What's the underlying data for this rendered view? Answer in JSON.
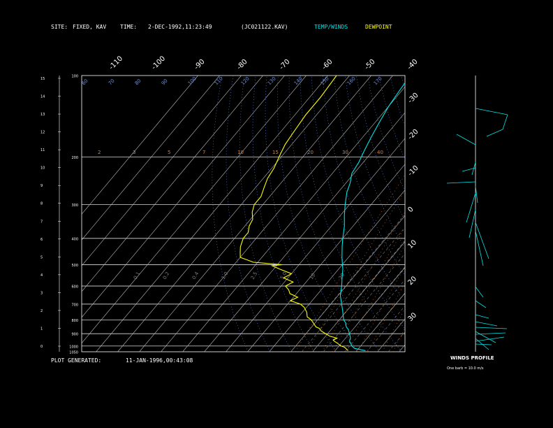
{
  "header": {
    "site_label": "SITE:",
    "site_value": "FIXED, KAV",
    "time_label": "TIME:",
    "time_value": "2-DEC-1992,11:23:49",
    "file_value": "(JC021122.KAV)",
    "temp_legend": "TEMP/WINDS",
    "dew_legend": "DEWPOINT"
  },
  "footer": {
    "generated_label": "PLOT GENERATED:",
    "generated_value": "11-JAN-1996,00:43:08"
  },
  "winds": {
    "title": "WINDS PROFILE",
    "note": "One barb = 10.0 m/s"
  },
  "colors": {
    "temperature": "#00e5e5",
    "dewpoint": "#ffff00",
    "isotherm": "#bbbbbb",
    "mixing_ratio": "#e67e22",
    "dry_adiabat": "#6a8ee6",
    "moist_adiabat": "#7a7a7a"
  },
  "chart_data": {
    "type": "line",
    "yscale": "log-pressure",
    "ylim": [
      1050,
      100
    ],
    "pressure_ticks": [
      "100",
      "200",
      "300",
      "400",
      "500",
      "600",
      "700",
      "800",
      "900",
      "1000",
      "1050"
    ],
    "pressure_values": [
      100,
      200,
      300,
      400,
      500,
      600,
      700,
      800,
      900,
      1000,
      1050
    ],
    "height_ticks": [
      "0",
      "1",
      "2",
      "3",
      "4",
      "5",
      "6",
      "7",
      "8",
      "9",
      "10",
      "11",
      "12",
      "13",
      "14",
      "15"
    ],
    "top_temp_ticks": [
      "-110",
      "-100",
      "-90",
      "-80",
      "-70",
      "-60",
      "-50",
      "-40"
    ],
    "right_temp_ticks": [
      "-30",
      "-20",
      "-10",
      "0",
      "10",
      "20",
      "30"
    ],
    "mixing_ratio_labels": [
      "2",
      "3",
      "5",
      "7",
      "10",
      "15",
      "20",
      "30",
      "40"
    ],
    "dry_adiabat_labels": [
      "60",
      "70",
      "80",
      "90",
      "100",
      "110",
      "120",
      "130",
      "140",
      "150",
      "160",
      "170"
    ],
    "moist_adiabat_labels": [
      "0.1",
      "0.2",
      "0.4",
      "1.0",
      "2.5",
      "5.0",
      "10",
      "20"
    ],
    "series": [
      {
        "name": "TEMP/WINDS",
        "points": [
          [
            1040,
            24
          ],
          [
            1020,
            18
          ],
          [
            1000,
            16
          ],
          [
            960,
            13
          ],
          [
            930,
            12
          ],
          [
            900,
            10
          ],
          [
            870,
            8
          ],
          [
            850,
            6
          ],
          [
            820,
            4
          ],
          [
            800,
            2
          ],
          [
            770,
            0
          ],
          [
            740,
            -2
          ],
          [
            700,
            -5
          ],
          [
            650,
            -9
          ],
          [
            600,
            -12
          ],
          [
            560,
            -15
          ],
          [
            520,
            -18
          ],
          [
            500,
            -20
          ],
          [
            470,
            -23
          ],
          [
            430,
            -27
          ],
          [
            400,
            -30
          ],
          [
            360,
            -34
          ],
          [
            330,
            -38
          ],
          [
            300,
            -42
          ],
          [
            270,
            -46
          ],
          [
            250,
            -48
          ],
          [
            230,
            -51
          ],
          [
            210,
            -52
          ],
          [
            190,
            -54
          ],
          [
            170,
            -56
          ],
          [
            150,
            -58
          ],
          [
            130,
            -60
          ],
          [
            115,
            -61
          ],
          [
            100,
            -62
          ]
        ]
      },
      {
        "name": "DEWPOINT",
        "points": [
          [
            1040,
            16
          ],
          [
            1010,
            13
          ],
          [
            1000,
            11
          ],
          [
            975,
            8
          ],
          [
            960,
            6
          ],
          [
            950,
            5
          ],
          [
            935,
            6
          ],
          [
            920,
            2
          ],
          [
            900,
            -1
          ],
          [
            880,
            -4
          ],
          [
            860,
            -6
          ],
          [
            850,
            -8
          ],
          [
            830,
            -10
          ],
          [
            800,
            -13
          ],
          [
            780,
            -16
          ],
          [
            750,
            -18
          ],
          [
            720,
            -21
          ],
          [
            700,
            -24
          ],
          [
            680,
            -30
          ],
          [
            660,
            -28
          ],
          [
            640,
            -33
          ],
          [
            620,
            -35
          ],
          [
            600,
            -38
          ],
          [
            580,
            -36
          ],
          [
            560,
            -42
          ],
          [
            540,
            -40
          ],
          [
            520,
            -47
          ],
          [
            505,
            -52
          ],
          [
            500,
            -48
          ],
          [
            490,
            -62
          ],
          [
            470,
            -70
          ],
          [
            450,
            -72
          ],
          [
            430,
            -74
          ],
          [
            400,
            -76
          ],
          [
            380,
            -76
          ],
          [
            360,
            -78
          ],
          [
            340,
            -79
          ],
          [
            320,
            -82
          ],
          [
            300,
            -84
          ],
          [
            280,
            -84
          ],
          [
            260,
            -86
          ],
          [
            240,
            -88
          ],
          [
            220,
            -89
          ],
          [
            200,
            -91
          ],
          [
            180,
            -93
          ],
          [
            160,
            -94
          ],
          [
            140,
            -95
          ],
          [
            120,
            -95
          ],
          [
            100,
            -96
          ]
        ]
      }
    ]
  }
}
